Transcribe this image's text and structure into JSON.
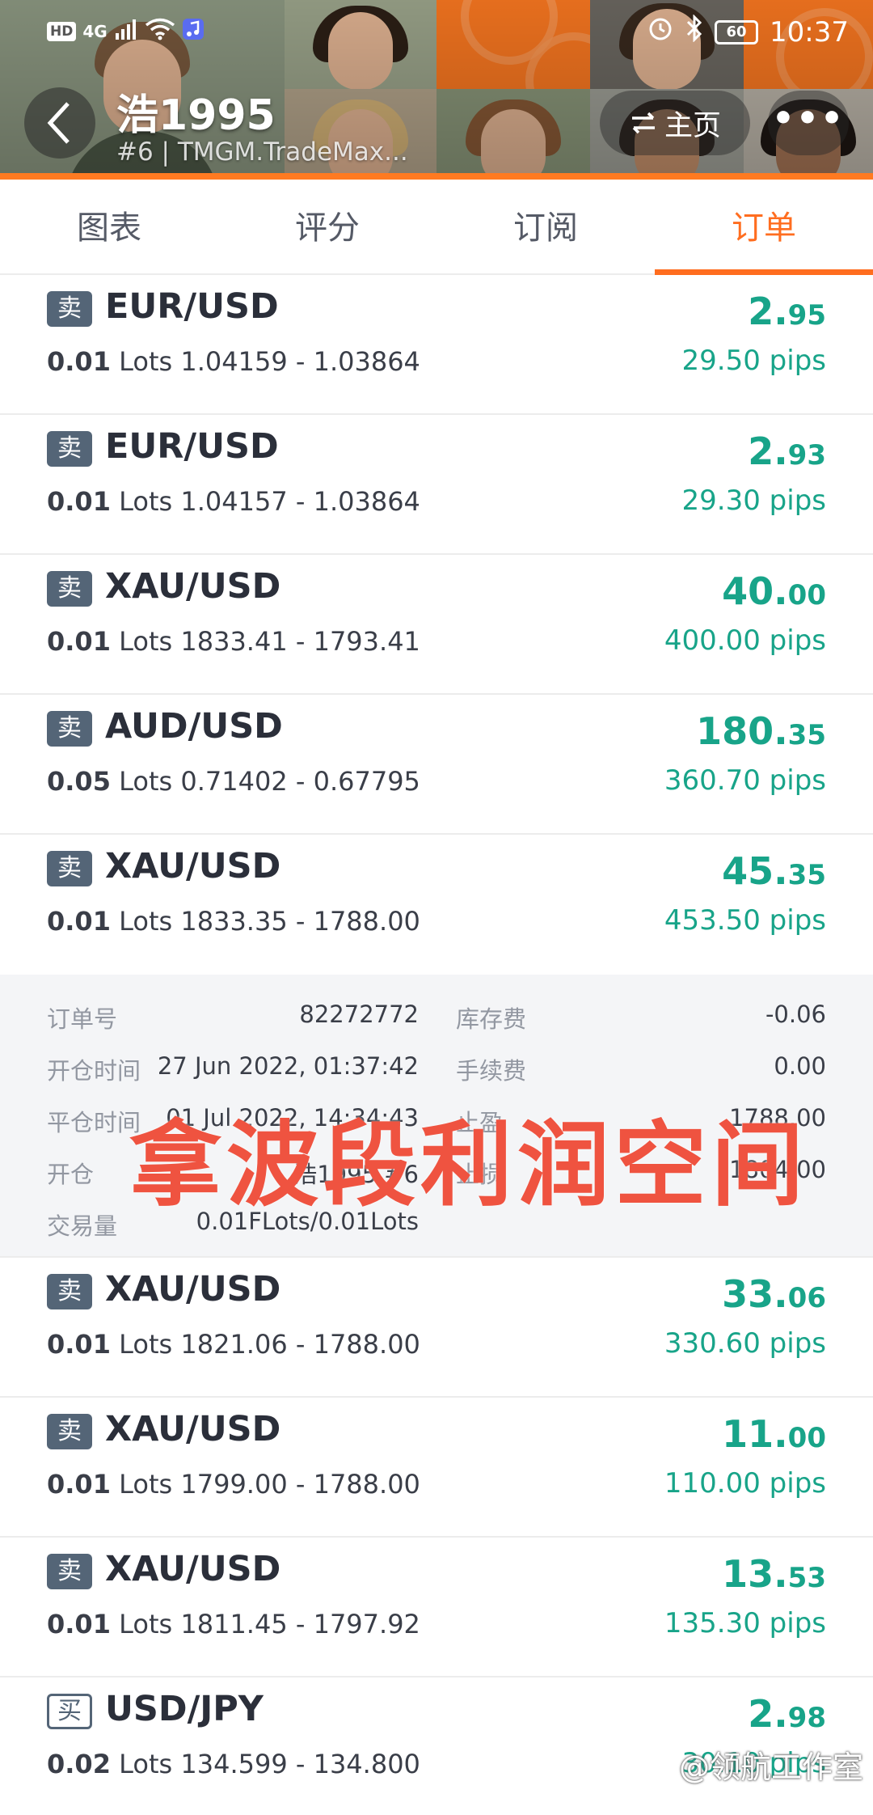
{
  "status_bar": {
    "left_hd": "HD",
    "left_net": "4G",
    "battery": "60",
    "time": "10:37"
  },
  "header": {
    "title": "浩1995",
    "subtitle": "#6 | TMGM.TradeMax...",
    "home_label": "主页",
    "more_label": "•••"
  },
  "tabs": [
    {
      "label": "图表",
      "active": false
    },
    {
      "label": "评分",
      "active": false
    },
    {
      "label": "订阅",
      "active": false
    },
    {
      "label": "订单",
      "active": true
    }
  ],
  "colors": {
    "accent": "#ff6d1f",
    "profit": "#18a489",
    "badge": "#546577",
    "overlay": "#ef5340"
  },
  "orders": [
    {
      "side": "卖",
      "symbol": "EUR/USD",
      "qty": "0.01",
      "lots": "Lots",
      "range": "1.04159 - 1.03864",
      "profit_int": "2.",
      "profit_dec": "95",
      "pips": "29.50 pips"
    },
    {
      "side": "卖",
      "symbol": "EUR/USD",
      "qty": "0.01",
      "lots": "Lots",
      "range": "1.04157 - 1.03864",
      "profit_int": "2.",
      "profit_dec": "93",
      "pips": "29.30 pips"
    },
    {
      "side": "卖",
      "symbol": "XAU/USD",
      "qty": "0.01",
      "lots": "Lots",
      "range": "1833.41 - 1793.41",
      "profit_int": "40.",
      "profit_dec": "00",
      "pips": "400.00 pips"
    },
    {
      "side": "卖",
      "symbol": "AUD/USD",
      "qty": "0.05",
      "lots": "Lots",
      "range": "0.71402 - 0.67795",
      "profit_int": "180.",
      "profit_dec": "35",
      "pips": "360.70 pips"
    },
    {
      "side": "卖",
      "symbol": "XAU/USD",
      "qty": "0.01",
      "lots": "Lots",
      "range": "1833.35 - 1788.00",
      "profit_int": "45.",
      "profit_dec": "35",
      "pips": "453.50 pips"
    },
    {
      "side": "卖",
      "symbol": "XAU/USD",
      "qty": "0.01",
      "lots": "Lots",
      "range": "1821.06 - 1788.00",
      "profit_int": "33.",
      "profit_dec": "06",
      "pips": "330.60 pips"
    },
    {
      "side": "卖",
      "symbol": "XAU/USD",
      "qty": "0.01",
      "lots": "Lots",
      "range": "1799.00 - 1788.00",
      "profit_int": "11.",
      "profit_dec": "00",
      "pips": "110.00 pips"
    },
    {
      "side": "卖",
      "symbol": "XAU/USD",
      "qty": "0.01",
      "lots": "Lots",
      "range": "1811.45 - 1797.92",
      "profit_int": "13.",
      "profit_dec": "53",
      "pips": "135.30 pips"
    },
    {
      "side": "买",
      "symbol": "USD/JPY",
      "qty": "0.02",
      "lots": "Lots",
      "range": "134.599 - 134.800",
      "profit_int": "2.",
      "profit_dec": "98",
      "pips": "30.10 pips"
    }
  ],
  "detail": {
    "order_no_label": "订单号",
    "order_no": "82272772",
    "swap_label": "库存费",
    "swap": "-0.06",
    "open_time_label": "开仓时间",
    "open_time": "27 Jun 2022, 01:37:42",
    "commission_label": "手续费",
    "commission": "0.00",
    "close_time_label": "平仓时间",
    "close_time": "01 Jul 2022, 14:34:43",
    "tp_label": "止盈",
    "tp": "1788.00",
    "open_label": "开仓",
    "open_value": "浩1995 #6",
    "sl_label": "止损",
    "sl": "1804.00",
    "volume_label": "交易量",
    "volume": "0.01FLots/0.01Lots"
  },
  "overlay_text": "拿波段利润空间",
  "watermark": "@领航工作室"
}
